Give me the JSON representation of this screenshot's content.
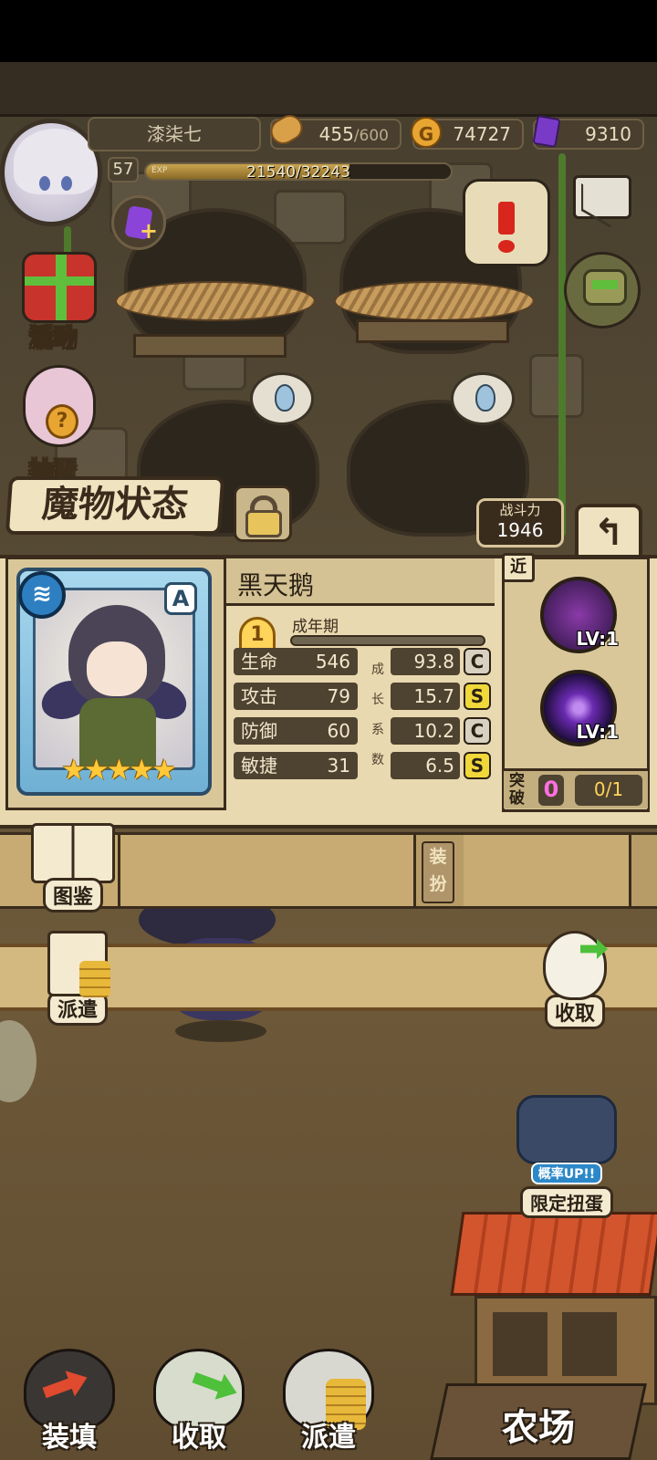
{
  "player": {
    "name": "漆柒七",
    "level": "57",
    "exp_label": "EXP",
    "exp_text": "21540/32243",
    "exp_fraction": 0.668
  },
  "resources": {
    "stamina_value": "455",
    "stamina_max": "/600",
    "gold": "74727",
    "gold_icon_text": "G",
    "gems": "9310"
  },
  "side_buttons": {
    "activity": "活动",
    "egg_partial": "抽蛋"
  },
  "panel": {
    "title": "魔物状态",
    "power_label": "战斗力",
    "power_value": "1946",
    "back_icon": "↰"
  },
  "monster": {
    "name": "黑天鹅",
    "rank": "A",
    "element_icon": "≋",
    "stars": "★★★★★",
    "star_count": 5,
    "stage_number": "1",
    "stage_name": "成年期",
    "stats": [
      {
        "label": "生命",
        "value": "546",
        "growth": "93.8",
        "grade": "C",
        "grade_class": "c"
      },
      {
        "label": "攻击",
        "value": "79",
        "growth": "15.7",
        "grade": "S",
        "grade_class": "s"
      },
      {
        "label": "防御",
        "value": "60",
        "growth": "10.2",
        "grade": "C",
        "grade_class": "c"
      },
      {
        "label": "敏捷",
        "value": "31",
        "growth": "6.5",
        "grade": "S",
        "grade_class": "s"
      }
    ],
    "growth_caption": [
      "成",
      "长",
      "系",
      "数"
    ]
  },
  "skills": {
    "range": "近",
    "items": [
      {
        "level": "LV:1"
      },
      {
        "level": "LV:1"
      }
    ],
    "breakthrough_label": "突破",
    "breakthrough_count": "0",
    "breakthrough_ratio": "0/1"
  },
  "lower": {
    "codex": "图鉴",
    "dress": "装扮",
    "dispatch": "派遣",
    "collect": "收取",
    "limited_rate": "概率UP!!",
    "limited_egg": "限定扭蛋"
  },
  "bottom_nav": {
    "load": "装填",
    "collect": "收取",
    "dispatch": "派遣",
    "farm": "农场"
  },
  "colors": {
    "accent_gold": "#ffc93a",
    "grade_s": "#f0d83a",
    "grade_c": "#d8d0c0",
    "breakthrough_count": "#ff70e0",
    "panel_bg": "#e9d9b0"
  }
}
